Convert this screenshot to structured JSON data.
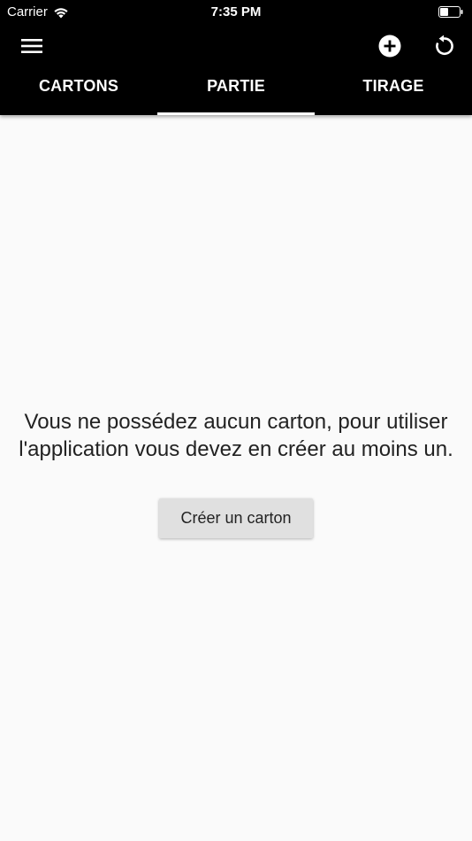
{
  "status_bar": {
    "carrier": "Carrier",
    "time": "7:35 PM"
  },
  "app_bar": {
    "icons": {
      "menu": "menu-icon",
      "add": "add-circle-icon",
      "refresh": "refresh-icon"
    },
    "tabs": [
      {
        "label": "CARTONS",
        "selected": false
      },
      {
        "label": "PARTIE",
        "selected": true
      },
      {
        "label": "TIRAGE",
        "selected": false
      }
    ]
  },
  "main": {
    "empty_message": "Vous ne possédez aucun carton, pour utiliser l'application vous devez en créer au moins un.",
    "create_button_label": "Créer un carton"
  },
  "colors": {
    "app_bar": "#000000",
    "background": "#fafafa",
    "button": "#e0e0e0"
  }
}
